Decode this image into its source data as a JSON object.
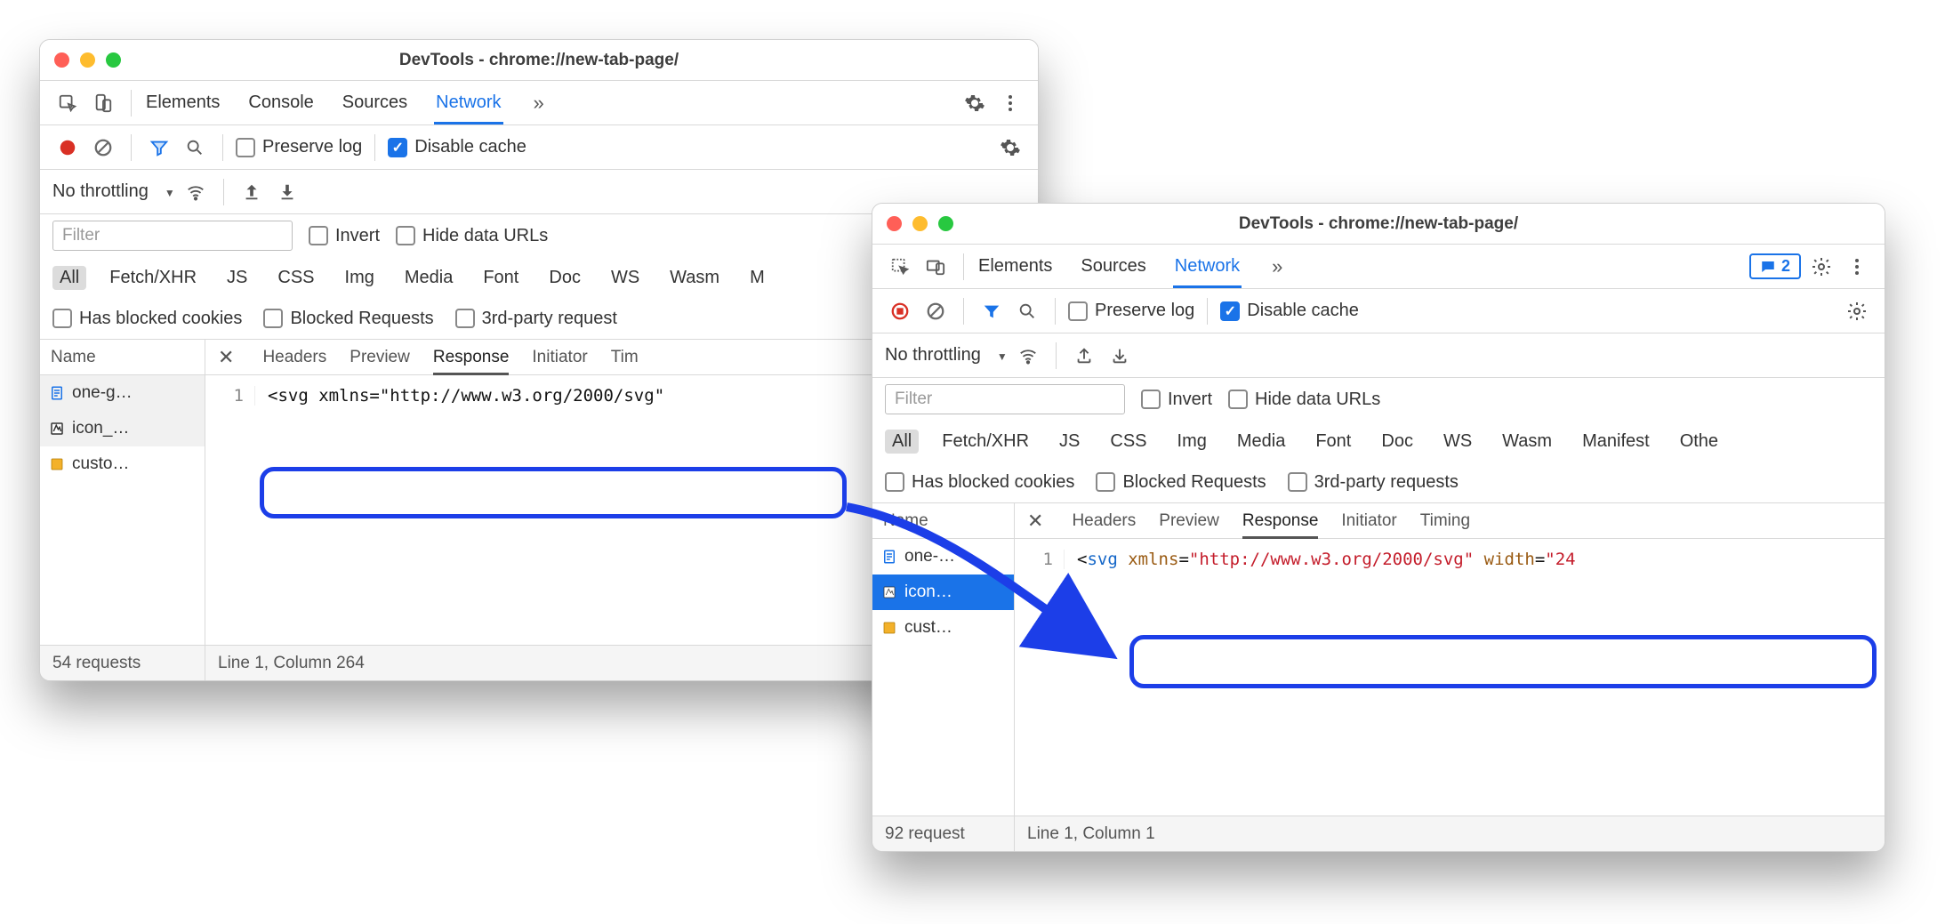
{
  "win1": {
    "title": "DevTools - chrome://new-tab-page/",
    "tabs": {
      "elements": "Elements",
      "console": "Console",
      "sources": "Sources",
      "network": "Network"
    },
    "opts": {
      "preserve": "Preserve log",
      "disable": "Disable cache"
    },
    "throttle": "No throttling",
    "filter_ph": "Filter",
    "invert": "Invert",
    "hideurls": "Hide data URLs",
    "types": [
      "All",
      "Fetch/XHR",
      "JS",
      "CSS",
      "Img",
      "Media",
      "Font",
      "Doc",
      "WS",
      "Wasm",
      "M"
    ],
    "checks": {
      "blockedcookies": "Has blocked cookies",
      "blockedreq": "Blocked Requests",
      "thirdparty": "3rd-party request"
    },
    "colName": "Name",
    "dtabs": {
      "headers": "Headers",
      "preview": "Preview",
      "response": "Response",
      "initiator": "Initiator",
      "timing": "Tim"
    },
    "files": [
      "one-g…",
      "icon_…",
      "custo…"
    ],
    "code_line_no": "1",
    "code_html": "<span class='c-plain'>&lt;svg </span><span class='c-plain'>xmlns=\"http://www.w3.org/2000/svg\"</span>",
    "status": {
      "left": "54 requests",
      "right": "Line 1, Column 264"
    }
  },
  "win2": {
    "title": "DevTools - chrome://new-tab-page/",
    "tabs": {
      "elements": "Elements",
      "sources": "Sources",
      "network": "Network"
    },
    "msg_count": "2",
    "opts": {
      "preserve": "Preserve log",
      "disable": "Disable cache"
    },
    "throttle": "No throttling",
    "filter_ph": "Filter",
    "invert": "Invert",
    "hideurls": "Hide data URLs",
    "types": [
      "All",
      "Fetch/XHR",
      "JS",
      "CSS",
      "Img",
      "Media",
      "Font",
      "Doc",
      "WS",
      "Wasm",
      "Manifest",
      "Othe"
    ],
    "checks": {
      "blockedcookies": "Has blocked cookies",
      "blockedreq": "Blocked Requests",
      "thirdparty": "3rd-party requests"
    },
    "colName": "Name",
    "dtabs": {
      "headers": "Headers",
      "preview": "Preview",
      "response": "Response",
      "initiator": "Initiator",
      "timing": "Timing"
    },
    "files": [
      "one-…",
      "icon…",
      "cust…"
    ],
    "code_line_no": "1",
    "code_html": "<span class='c-plain'>&lt;</span><span class='c-tag'>svg</span> <span class='c-attr'>xmlns</span><span class='c-plain'>=</span><span class='c-str'>\"http://www.w3.org/2000/svg\"</span> <span class='c-attr'>width</span><span class='c-plain'>=</span><span class='c-str'>\"24</span>",
    "status": {
      "left": "92 request",
      "right": "Line 1, Column 1"
    }
  }
}
